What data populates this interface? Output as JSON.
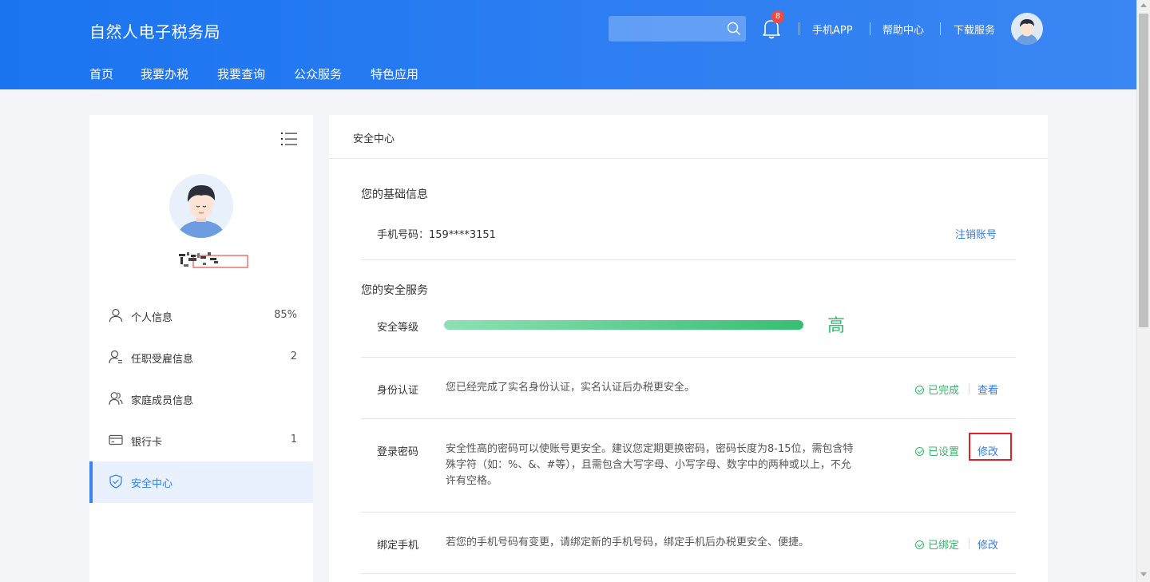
{
  "header": {
    "brand": "自然人电子税务局",
    "notification_count": "8",
    "links": [
      "手机APP",
      "帮助中心",
      "下载服务"
    ],
    "nav": [
      "首页",
      "我要办税",
      "我要查询",
      "公众服务",
      "特色应用"
    ]
  },
  "sidebar": {
    "items": [
      {
        "label": "个人信息",
        "count": "85%",
        "icon": "user-icon"
      },
      {
        "label": "任职受雇信息",
        "count": "2",
        "icon": "employment-user-icon"
      },
      {
        "label": "家庭成员信息",
        "count": "",
        "icon": "family-users-icon"
      },
      {
        "label": "银行卡",
        "count": "1",
        "icon": "bank-card-icon"
      },
      {
        "label": "安全中心",
        "count": "",
        "icon": "shield-icon"
      }
    ],
    "active_index": 4
  },
  "main": {
    "title": "安全中心",
    "basic_section": "您的基础信息",
    "phone_label": "手机号码：159****3151",
    "cancel_account": "注销账号",
    "security_section": "您的安全服务",
    "security_level_label": "安全等级",
    "security_level_value": "高",
    "security_level_fraction": 1.0,
    "rows": [
      {
        "label": "身份认证",
        "desc": "您已经完成了实名身份认证，实名认证后办税更安全。",
        "status": "已完成",
        "action": "查看"
      },
      {
        "label": "登录密码",
        "desc": "安全性高的密码可以使账号更安全。建议您定期更换密码，密码长度为8-15位，需包含特殊字符（如：%、&、#等），且需包含大写字母、小写字母、数字中的两种或以上，不允许有空格。",
        "status": "已设置",
        "action": "修改"
      },
      {
        "label": "绑定手机",
        "desc": "若您的手机号码有变更，请绑定新的手机号码，绑定手机后办税更安全、便捷。",
        "status": "已绑定",
        "action": "修改"
      }
    ]
  },
  "colors": {
    "header_blue": "#2f7ff2",
    "accent_blue": "#3a84f2",
    "status_green": "#39b36b",
    "highlight_red": "#e2202a"
  }
}
